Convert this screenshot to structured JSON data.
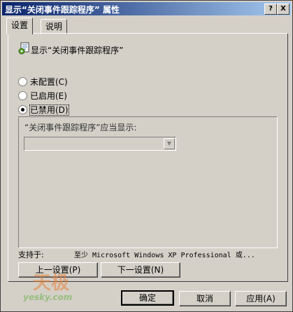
{
  "window": {
    "title": "显示“关闭事件跟踪程序” 属性",
    "help_label": "?",
    "close_label": "X"
  },
  "tabs": [
    {
      "label": "设置",
      "active": true
    },
    {
      "label": "说明",
      "active": false
    }
  ],
  "policy": {
    "icon": "policy-setting-icon",
    "title": "显示“关闭事件跟踪程序”"
  },
  "radios": [
    {
      "label": "未配置(C)",
      "checked": false
    },
    {
      "label": "已启用(E)",
      "checked": false
    },
    {
      "label": "已禁用(D)",
      "checked": true
    }
  ],
  "options": {
    "label": "“关闭事件跟踪程序”应当显示:",
    "dropdown_value": ""
  },
  "supported": {
    "label": "支持于:",
    "value": "至少 Microsoft Windows XP Professional 或..."
  },
  "nav": {
    "prev_label": "上一设置(P)",
    "next_label": "下一设置(N)"
  },
  "footer": {
    "ok_label": "确定",
    "cancel_label": "取消",
    "apply_label": "应用(A)"
  },
  "watermark": {
    "brand_cn": "天极",
    "brand_url": "yesky.com"
  },
  "colors": {
    "titlebar_start": "#0a246a",
    "titlebar_end": "#a6caf0",
    "face": "#d4d0c8"
  }
}
